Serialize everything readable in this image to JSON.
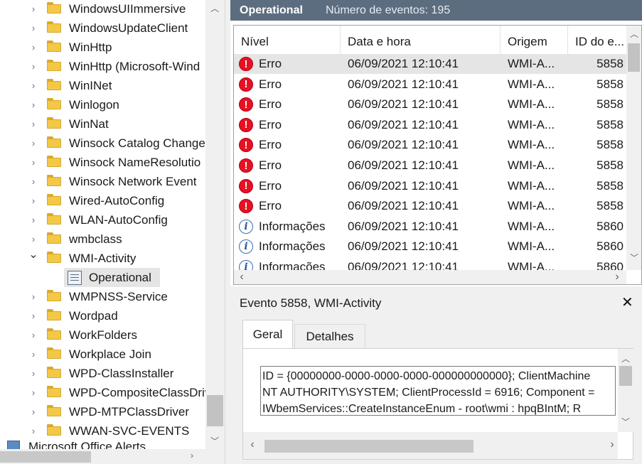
{
  "tree": {
    "items": [
      {
        "label": "WindowsUIImmersive",
        "expanded": false
      },
      {
        "label": "WindowsUpdateClient",
        "expanded": false
      },
      {
        "label": "WinHttp",
        "expanded": false
      },
      {
        "label": "WinHttp (Microsoft-Wind",
        "expanded": false
      },
      {
        "label": "WinINet",
        "expanded": false
      },
      {
        "label": "Winlogon",
        "expanded": false
      },
      {
        "label": "WinNat",
        "expanded": false
      },
      {
        "label": "Winsock Catalog Change",
        "expanded": false
      },
      {
        "label": "Winsock NameResolutio",
        "expanded": false
      },
      {
        "label": "Winsock Network Event",
        "expanded": false
      },
      {
        "label": "Wired-AutoConfig",
        "expanded": false
      },
      {
        "label": "WLAN-AutoConfig",
        "expanded": false
      },
      {
        "label": "wmbclass",
        "expanded": false
      },
      {
        "label": "WMI-Activity",
        "expanded": true
      },
      {
        "label": "Operational",
        "child": true,
        "selected": true
      },
      {
        "label": "WMPNSS-Service",
        "expanded": false
      },
      {
        "label": "Wordpad",
        "expanded": false
      },
      {
        "label": "WorkFolders",
        "expanded": false
      },
      {
        "label": "Workplace Join",
        "expanded": false
      },
      {
        "label": "WPD-ClassInstaller",
        "expanded": false
      },
      {
        "label": "WPD-CompositeClassDriv",
        "expanded": false
      },
      {
        "label": "WPD-MTPClassDriver",
        "expanded": false
      },
      {
        "label": "WWAN-SVC-EVENTS",
        "expanded": false
      }
    ],
    "bottom_item": "Microsoft Office Alerts"
  },
  "header": {
    "title": "Operational",
    "count": "Número de eventos: 195"
  },
  "grid": {
    "columns": [
      "Nível",
      "Data e hora",
      "Origem",
      "ID do e..."
    ],
    "rows": [
      {
        "level": "Erro",
        "icon": "error-icon",
        "date": "06/09/2021 12:10:41",
        "source": "WMI-A...",
        "id": "5858",
        "selected": true
      },
      {
        "level": "Erro",
        "icon": "error-icon",
        "date": "06/09/2021 12:10:41",
        "source": "WMI-A...",
        "id": "5858"
      },
      {
        "level": "Erro",
        "icon": "error-icon",
        "date": "06/09/2021 12:10:41",
        "source": "WMI-A...",
        "id": "5858"
      },
      {
        "level": "Erro",
        "icon": "error-icon",
        "date": "06/09/2021 12:10:41",
        "source": "WMI-A...",
        "id": "5858"
      },
      {
        "level": "Erro",
        "icon": "error-icon",
        "date": "06/09/2021 12:10:41",
        "source": "WMI-A...",
        "id": "5858"
      },
      {
        "level": "Erro",
        "icon": "error-icon",
        "date": "06/09/2021 12:10:41",
        "source": "WMI-A...",
        "id": "5858"
      },
      {
        "level": "Erro",
        "icon": "error-icon",
        "date": "06/09/2021 12:10:41",
        "source": "WMI-A...",
        "id": "5858"
      },
      {
        "level": "Erro",
        "icon": "error-icon",
        "date": "06/09/2021 12:10:41",
        "source": "WMI-A...",
        "id": "5858"
      },
      {
        "level": "Informações",
        "icon": "info-icon",
        "date": "06/09/2021 12:10:41",
        "source": "WMI-A...",
        "id": "5860"
      },
      {
        "level": "Informações",
        "icon": "info-icon",
        "date": "06/09/2021 12:10:41",
        "source": "WMI-A...",
        "id": "5860"
      },
      {
        "level": "Informações",
        "icon": "info-icon",
        "date": "06/09/2021 12:10:41",
        "source": "WMI-A...",
        "id": "5860"
      }
    ]
  },
  "detail": {
    "title": "Evento 5858, WMI-Activity",
    "close": "✕",
    "tabs": [
      "Geral",
      "Detalhes"
    ],
    "text_lines": [
      "ID = {00000000-0000-0000-0000-000000000000}; ClientMachine",
      "NT AUTHORITY\\SYSTEM; ClientProcessId = 6916; Component =",
      "IWbemServices::CreateInstanceEnum - root\\wmi : hpqBIntM; R"
    ]
  },
  "colors": {
    "header_bg": "#5d6d80",
    "selection": "#e5e5e5",
    "error": "#e81123",
    "info": "#3a6db3",
    "folder": "#f3c845"
  }
}
